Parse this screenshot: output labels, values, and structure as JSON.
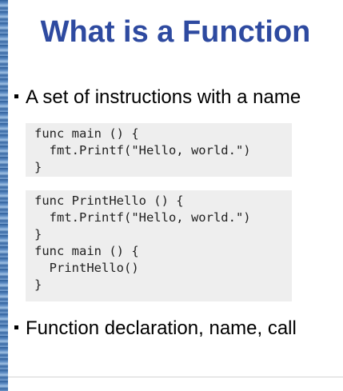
{
  "slide": {
    "title": "What is a Function",
    "bullets": [
      "A set of instructions with a name",
      "Function declaration, name, call"
    ],
    "code_blocks": [
      {
        "lines": [
          "func main () {",
          "  fmt.Printf(\"Hello, world.\")",
          "}"
        ]
      },
      {
        "lines": [
          "func PrintHello () {",
          "  fmt.Printf(\"Hello, world.\")",
          "}",
          "func main () {",
          "  PrintHello()",
          "}"
        ]
      }
    ]
  }
}
